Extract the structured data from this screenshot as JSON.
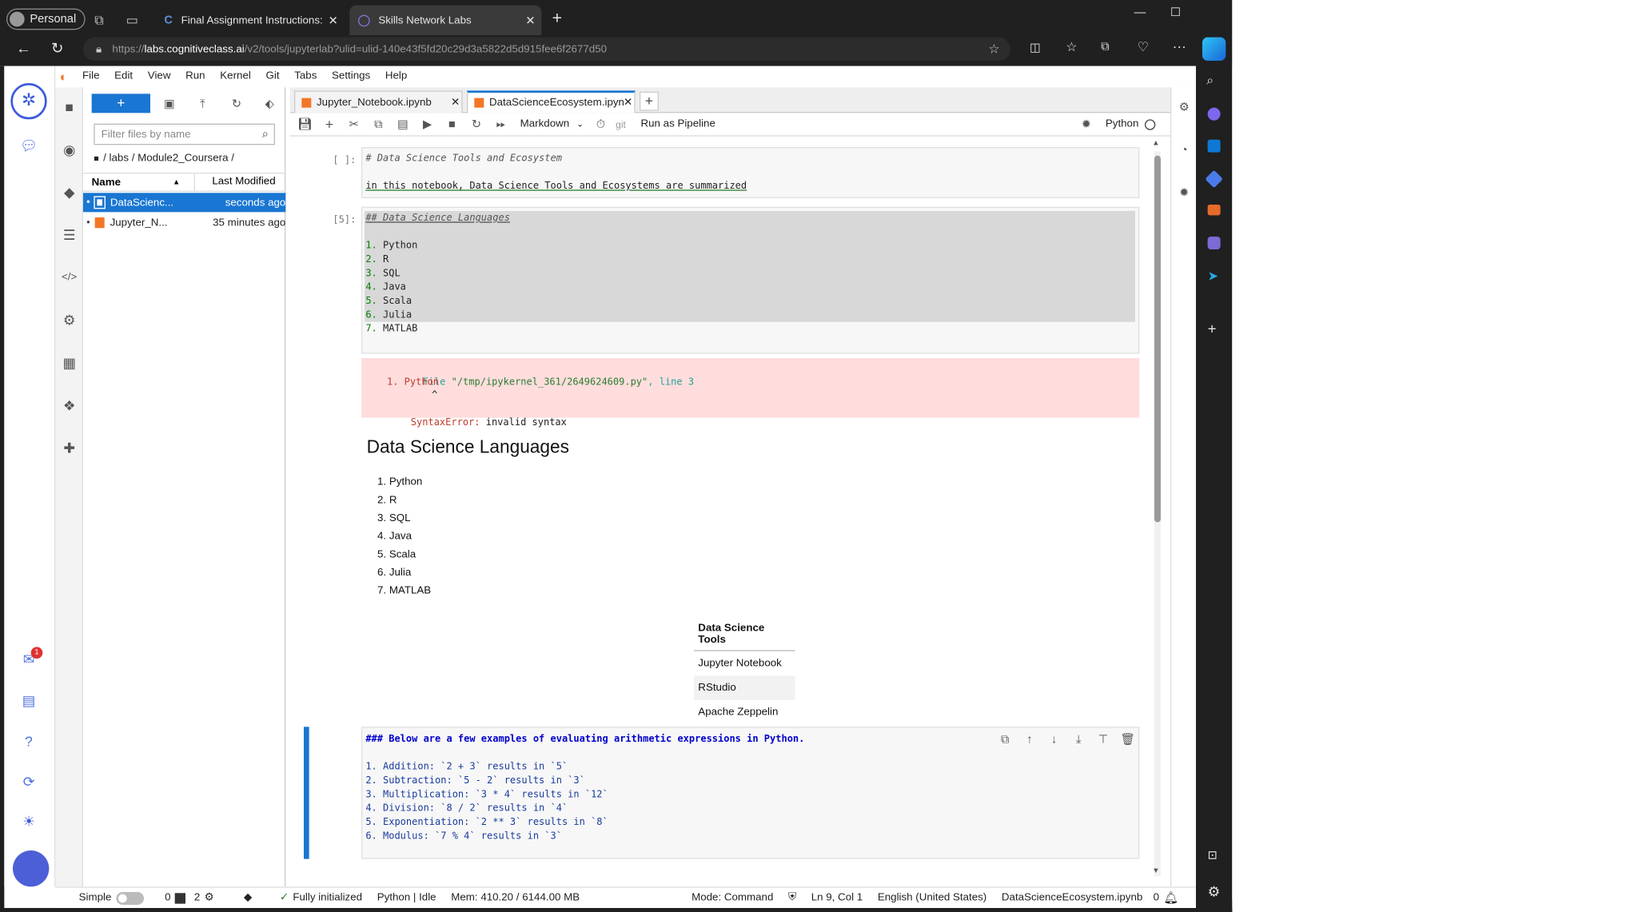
{
  "browser": {
    "profile_label": "Personal",
    "tabs": [
      {
        "label": "Final Assignment Instructions: Co",
        "icon": "coursera-icon",
        "active": false
      },
      {
        "label": "Skills Network Labs",
        "icon": "skillsnetwork-icon",
        "active": true
      }
    ],
    "new_tab_label": "+",
    "url_prefix": "https://",
    "url_domain": "labs.cognitiveclass.ai",
    "url_path": "/v2/tools/jupyterlab?ulid=ulid-140e43f5fd20c29d3a5822d5d915fee6f2677d50",
    "window_controls": {
      "minimize": "—",
      "maximize": "☐",
      "close": "✕"
    }
  },
  "menubar": {
    "items": [
      "File",
      "Edit",
      "View",
      "Run",
      "Kernel",
      "Git",
      "Tabs",
      "Settings",
      "Help"
    ]
  },
  "filebrowser": {
    "new_button_label": "+",
    "filter_placeholder": "Filter files by name",
    "breadcrumb": "/ labs / Module2_Coursera /",
    "col_name": "Name",
    "col_modified": "Last Modified",
    "files": [
      {
        "name": "DataScienc...",
        "modified": "seconds ago",
        "selected": true
      },
      {
        "name": "Jupyter_N...",
        "modified": "35 minutes ago",
        "selected": false
      }
    ]
  },
  "notebook_tabs": [
    {
      "label": "Jupyter_Notebook.ipynb",
      "active": false
    },
    {
      "label": "DataScienceEcosystem.ipyn",
      "active": true
    }
  ],
  "toolbar": {
    "cell_type": "Markdown",
    "git_label": "git",
    "run_pipeline_label": "Run as Pipeline",
    "kernel_name": "Python"
  },
  "cells": {
    "cell1": {
      "prompt": "[ ]:",
      "line1": "# Data Science Tools and Ecosystem",
      "line2": "in this notebook, Data Science Tools and Ecosystems are summarized"
    },
    "cell2": {
      "prompt": "[5]:",
      "heading": "## Data Science Languages",
      "lines": [
        "Python",
        "R",
        "SQL",
        "Java",
        "Scala",
        "Julia",
        "MATLAB"
      ],
      "nums": [
        "1.",
        "2.",
        "3.",
        "4.",
        "5.",
        "6.",
        "7."
      ]
    },
    "error": {
      "file_prefix": "File",
      "file_path": "\"/tmp/ipykernel_361/2649624609.py\"",
      "line_word": ", line",
      "line_no": "3",
      "code_line": "1. Python",
      "caret": "^",
      "err_name": "SyntaxError:",
      "err_msg": "invalid syntax"
    },
    "rendered": {
      "heading": "Data Science Languages",
      "items": [
        "Python",
        "R",
        "SQL",
        "Java",
        "Scala",
        "Julia",
        "MATLAB"
      ],
      "nums": [
        "1.",
        "2.",
        "3.",
        "4.",
        "5.",
        "6.",
        "7."
      ],
      "table_header": "Data Science Tools",
      "table_rows": [
        "Jupyter Notebook",
        "RStudio",
        "Apache Zeppelin"
      ]
    },
    "cell4": {
      "heading": "### Below are a few examples of evaluating arithmetic expressions in Python.",
      "lines": [
        "1. Addition: `2 + 3` results in `5`",
        "2. Subtraction: `5 - 2` results in `3`",
        "3. Multiplication: `3 * 4` results in `12`",
        "4. Division: `8 / 2` results in `4`",
        "5. Exponentiation: `2 ** 3` results in `8`",
        "6. Modulus: `7 % 4` results in `3`"
      ]
    }
  },
  "statusbar": {
    "mode_simple": "Simple",
    "terminals": "0",
    "kernels": "2",
    "init": "Fully initialized",
    "kernel_status": "Python | Idle",
    "mem": "Mem: 410.20 / 6144.00 MB",
    "mode": "Mode: Command",
    "position": "Ln 9, Col 1",
    "language": "English (United States)",
    "filename": "DataScienceEcosystem.ipynb",
    "notifications": "0"
  },
  "left_rail": {
    "notification_badge": "1"
  },
  "colors": {
    "accent": "#1976d2",
    "error_bg": "#ffdddd",
    "selected_cell_bar": "#1976d2",
    "browser_dark": "#202020"
  }
}
